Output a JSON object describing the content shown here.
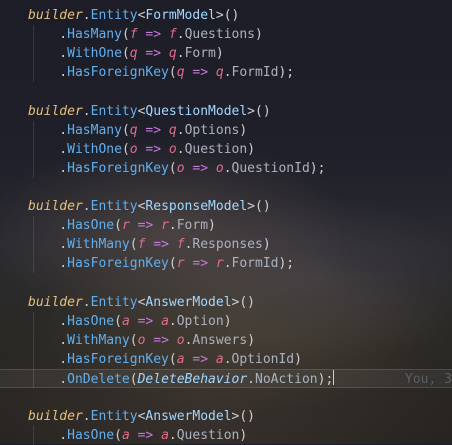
{
  "editor": {
    "lines": [
      {
        "t": [
          {
            "c": "builder",
            "k": "builder"
          },
          {
            "c": ".",
            "k": "punc"
          },
          {
            "c": "Entity",
            "k": "method"
          },
          {
            "c": "<",
            "k": "punc"
          },
          {
            "c": "FormModel",
            "k": "type"
          },
          {
            "c": ">()",
            "k": "punc"
          }
        ]
      },
      {
        "t": [
          {
            "c": "    .",
            "k": "punc"
          },
          {
            "c": "HasMany",
            "k": "method"
          },
          {
            "c": "(",
            "k": "punc"
          },
          {
            "c": "f",
            "k": "param"
          },
          {
            "c": " => ",
            "k": "arrow"
          },
          {
            "c": "f",
            "k": "param"
          },
          {
            "c": ".",
            "k": "punc"
          },
          {
            "c": "Questions",
            "k": "id"
          },
          {
            "c": ")",
            "k": "punc"
          }
        ]
      },
      {
        "t": [
          {
            "c": "    .",
            "k": "punc"
          },
          {
            "c": "WithOne",
            "k": "method"
          },
          {
            "c": "(",
            "k": "punc"
          },
          {
            "c": "q",
            "k": "param"
          },
          {
            "c": " => ",
            "k": "arrow"
          },
          {
            "c": "q",
            "k": "param"
          },
          {
            "c": ".",
            "k": "punc"
          },
          {
            "c": "Form",
            "k": "id"
          },
          {
            "c": ")",
            "k": "punc"
          }
        ]
      },
      {
        "t": [
          {
            "c": "    .",
            "k": "punc"
          },
          {
            "c": "HasForeignKey",
            "k": "method"
          },
          {
            "c": "(",
            "k": "punc"
          },
          {
            "c": "q",
            "k": "param"
          },
          {
            "c": " => ",
            "k": "arrow"
          },
          {
            "c": "q",
            "k": "param"
          },
          {
            "c": ".",
            "k": "punc"
          },
          {
            "c": "FormId",
            "k": "id"
          },
          {
            "c": ");",
            "k": "punc"
          }
        ]
      },
      {
        "t": []
      },
      {
        "t": [
          {
            "c": "builder",
            "k": "builder"
          },
          {
            "c": ".",
            "k": "punc"
          },
          {
            "c": "Entity",
            "k": "method"
          },
          {
            "c": "<",
            "k": "punc"
          },
          {
            "c": "QuestionModel",
            "k": "type"
          },
          {
            "c": ">()",
            "k": "punc"
          }
        ]
      },
      {
        "t": [
          {
            "c": "    .",
            "k": "punc"
          },
          {
            "c": "HasMany",
            "k": "method"
          },
          {
            "c": "(",
            "k": "punc"
          },
          {
            "c": "q",
            "k": "param"
          },
          {
            "c": " => ",
            "k": "arrow"
          },
          {
            "c": "q",
            "k": "param"
          },
          {
            "c": ".",
            "k": "punc"
          },
          {
            "c": "Options",
            "k": "id"
          },
          {
            "c": ")",
            "k": "punc"
          }
        ]
      },
      {
        "t": [
          {
            "c": "    .",
            "k": "punc"
          },
          {
            "c": "WithOne",
            "k": "method"
          },
          {
            "c": "(",
            "k": "punc"
          },
          {
            "c": "o",
            "k": "param"
          },
          {
            "c": " => ",
            "k": "arrow"
          },
          {
            "c": "o",
            "k": "param"
          },
          {
            "c": ".",
            "k": "punc"
          },
          {
            "c": "Question",
            "k": "id"
          },
          {
            "c": ")",
            "k": "punc"
          }
        ]
      },
      {
        "t": [
          {
            "c": "    .",
            "k": "punc"
          },
          {
            "c": "HasForeignKey",
            "k": "method"
          },
          {
            "c": "(",
            "k": "punc"
          },
          {
            "c": "o",
            "k": "param"
          },
          {
            "c": " => ",
            "k": "arrow"
          },
          {
            "c": "o",
            "k": "param"
          },
          {
            "c": ".",
            "k": "punc"
          },
          {
            "c": "QuestionId",
            "k": "id"
          },
          {
            "c": ");",
            "k": "punc"
          }
        ]
      },
      {
        "t": []
      },
      {
        "t": [
          {
            "c": "builder",
            "k": "builder"
          },
          {
            "c": ".",
            "k": "punc"
          },
          {
            "c": "Entity",
            "k": "method"
          },
          {
            "c": "<",
            "k": "punc"
          },
          {
            "c": "ResponseModel",
            "k": "type"
          },
          {
            "c": ">()",
            "k": "punc"
          }
        ]
      },
      {
        "t": [
          {
            "c": "    .",
            "k": "punc"
          },
          {
            "c": "HasOne",
            "k": "method"
          },
          {
            "c": "(",
            "k": "punc"
          },
          {
            "c": "r",
            "k": "param"
          },
          {
            "c": " => ",
            "k": "arrow"
          },
          {
            "c": "r",
            "k": "param"
          },
          {
            "c": ".",
            "k": "punc"
          },
          {
            "c": "Form",
            "k": "id"
          },
          {
            "c": ")",
            "k": "punc"
          }
        ]
      },
      {
        "t": [
          {
            "c": "    .",
            "k": "punc"
          },
          {
            "c": "WithMany",
            "k": "method"
          },
          {
            "c": "(",
            "k": "punc"
          },
          {
            "c": "f",
            "k": "param"
          },
          {
            "c": " => ",
            "k": "arrow"
          },
          {
            "c": "f",
            "k": "param"
          },
          {
            "c": ".",
            "k": "punc"
          },
          {
            "c": "Responses",
            "k": "id"
          },
          {
            "c": ")",
            "k": "punc"
          }
        ]
      },
      {
        "t": [
          {
            "c": "    .",
            "k": "punc"
          },
          {
            "c": "HasForeignKey",
            "k": "method"
          },
          {
            "c": "(",
            "k": "punc"
          },
          {
            "c": "r",
            "k": "param"
          },
          {
            "c": " => ",
            "k": "arrow"
          },
          {
            "c": "r",
            "k": "param"
          },
          {
            "c": ".",
            "k": "punc"
          },
          {
            "c": "FormId",
            "k": "id"
          },
          {
            "c": ");",
            "k": "punc"
          }
        ]
      },
      {
        "t": []
      },
      {
        "t": [
          {
            "c": "builder",
            "k": "builder"
          },
          {
            "c": ".",
            "k": "punc"
          },
          {
            "c": "Entity",
            "k": "method"
          },
          {
            "c": "<",
            "k": "punc"
          },
          {
            "c": "AnswerModel",
            "k": "type"
          },
          {
            "c": ">()",
            "k": "punc"
          }
        ]
      },
      {
        "t": [
          {
            "c": "    .",
            "k": "punc"
          },
          {
            "c": "HasOne",
            "k": "method"
          },
          {
            "c": "(",
            "k": "punc"
          },
          {
            "c": "a",
            "k": "param"
          },
          {
            "c": " => ",
            "k": "arrow"
          },
          {
            "c": "a",
            "k": "param"
          },
          {
            "c": ".",
            "k": "punc"
          },
          {
            "c": "Option",
            "k": "id"
          },
          {
            "c": ")",
            "k": "punc"
          }
        ]
      },
      {
        "t": [
          {
            "c": "    .",
            "k": "punc"
          },
          {
            "c": "WithMany",
            "k": "method"
          },
          {
            "c": "(",
            "k": "punc"
          },
          {
            "c": "o",
            "k": "param"
          },
          {
            "c": " => ",
            "k": "arrow"
          },
          {
            "c": "o",
            "k": "param"
          },
          {
            "c": ".",
            "k": "punc"
          },
          {
            "c": "Answers",
            "k": "id"
          },
          {
            "c": ")",
            "k": "punc"
          }
        ]
      },
      {
        "t": [
          {
            "c": "    .",
            "k": "punc"
          },
          {
            "c": "HasForeignKey",
            "k": "method"
          },
          {
            "c": "(",
            "k": "punc"
          },
          {
            "c": "a",
            "k": "param"
          },
          {
            "c": " => ",
            "k": "arrow"
          },
          {
            "c": "a",
            "k": "param"
          },
          {
            "c": ".",
            "k": "punc"
          },
          {
            "c": "OptionId",
            "k": "id"
          },
          {
            "c": ")",
            "k": "punc"
          }
        ]
      },
      {
        "t": [
          {
            "c": "    .",
            "k": "punc"
          },
          {
            "c": "OnDelete",
            "k": "method"
          },
          {
            "c": "(",
            "k": "punc"
          },
          {
            "c": "DeleteBehavior",
            "k": "italicprop"
          },
          {
            "c": ".",
            "k": "punc"
          },
          {
            "c": "NoAction",
            "k": "id"
          },
          {
            "c": ");",
            "k": "punc"
          }
        ],
        "current": true,
        "blame": "You, 3"
      },
      {
        "t": []
      },
      {
        "t": [
          {
            "c": "builder",
            "k": "builder"
          },
          {
            "c": ".",
            "k": "punc"
          },
          {
            "c": "Entity",
            "k": "method"
          },
          {
            "c": "<",
            "k": "punc"
          },
          {
            "c": "AnswerModel",
            "k": "type"
          },
          {
            "c": ">()",
            "k": "punc"
          }
        ]
      },
      {
        "t": [
          {
            "c": "    .",
            "k": "punc"
          },
          {
            "c": "HasOne",
            "k": "method"
          },
          {
            "c": "(",
            "k": "punc"
          },
          {
            "c": "a",
            "k": "param"
          },
          {
            "c": " => ",
            "k": "arrow"
          },
          {
            "c": "a",
            "k": "param"
          },
          {
            "c": ".",
            "k": "punc"
          },
          {
            "c": "Question",
            "k": "id"
          },
          {
            "c": ")",
            "k": "punc"
          }
        ]
      }
    ]
  },
  "colors": {
    "builder": "#e5c07b",
    "method": "#61afef",
    "type": "#a3d7ff",
    "param": "#e06c8f",
    "arrow": "#c678dd"
  }
}
